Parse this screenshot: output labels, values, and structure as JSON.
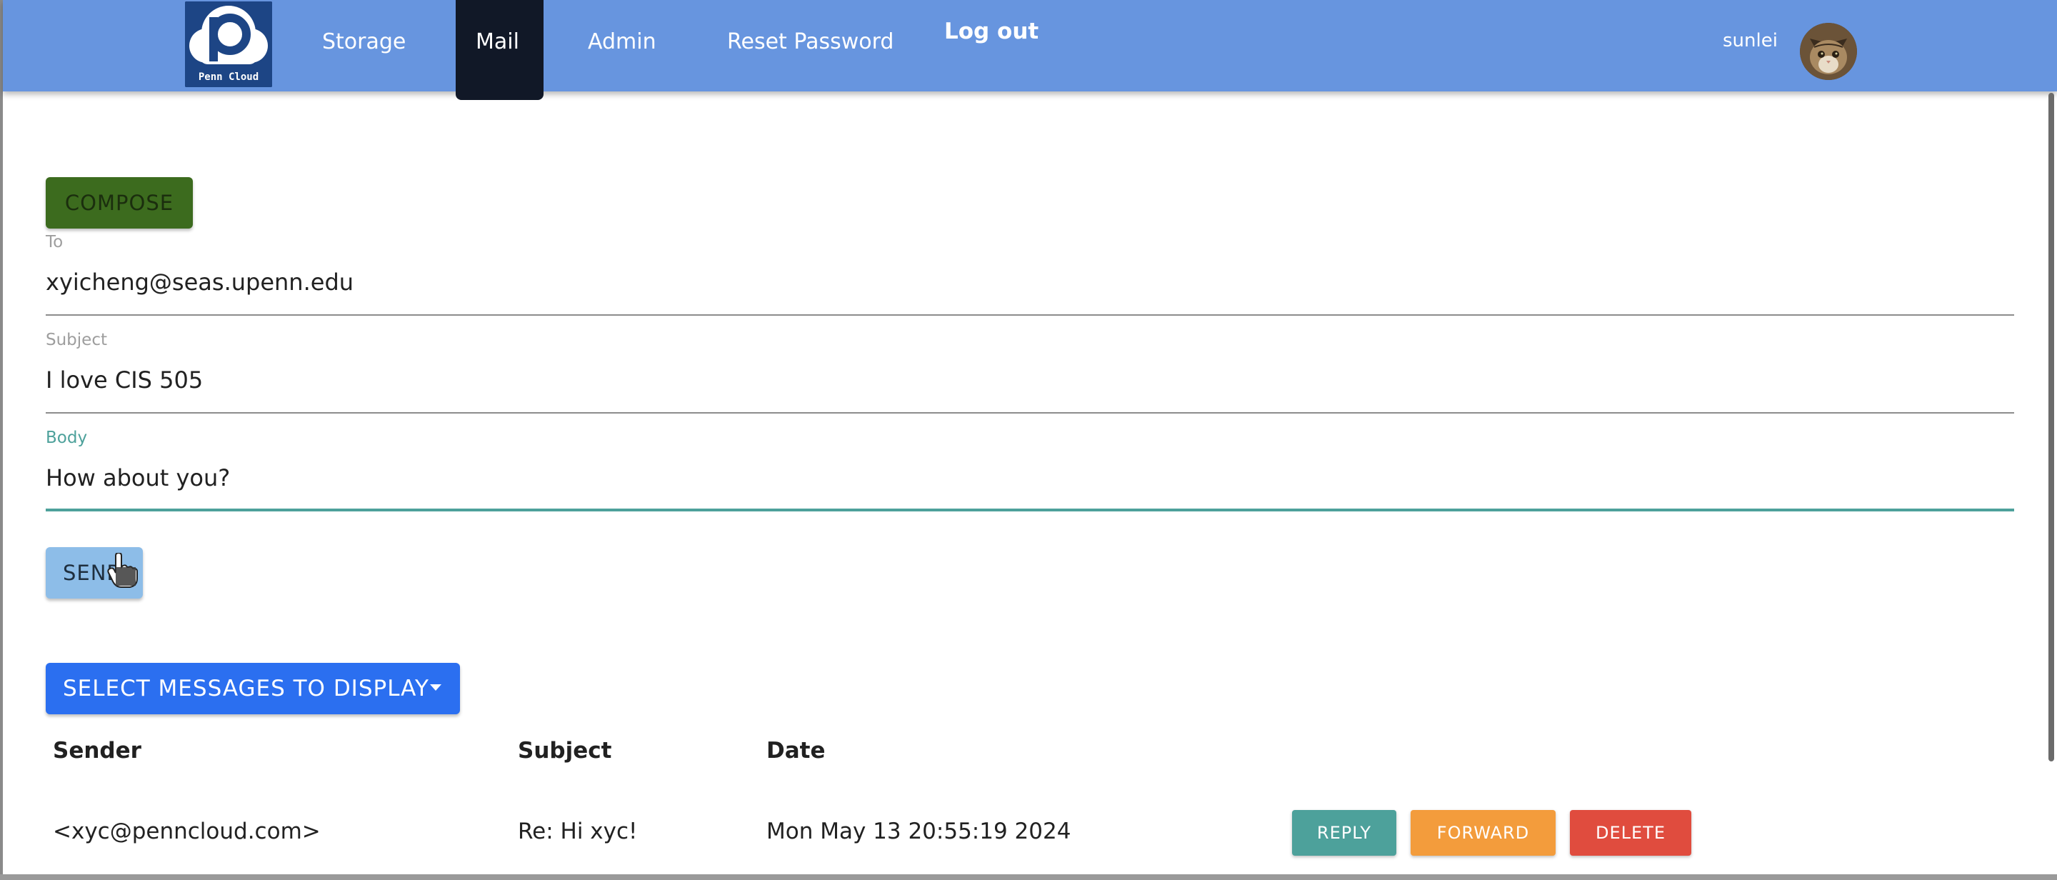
{
  "nav": {
    "logo_text": "Penn Cloud",
    "items": [
      {
        "label": "Storage"
      },
      {
        "label": "Mail"
      },
      {
        "label": "Admin"
      },
      {
        "label": "Reset Password"
      }
    ],
    "logout": "Log out",
    "username": "sunlei"
  },
  "compose": {
    "button": "COMPOSE",
    "to_label": "To",
    "to_value": "xyicheng@seas.upenn.edu",
    "subject_label": "Subject",
    "subject_value": "I love CIS 505",
    "body_label": "Body",
    "body_value": "How about you?",
    "send_button": "SEND"
  },
  "messages": {
    "select_button": "SELECT MESSAGES TO DISPLAY",
    "columns": [
      "Sender",
      "Subject",
      "Date"
    ],
    "rows": [
      {
        "sender": "<xyc@penncloud.com>",
        "subject": "Re: Hi xyc!",
        "date": "Mon May 13 20:55:19 2024",
        "actions": {
          "reply": "REPLY",
          "forward": "FORWARD",
          "delete": "DELETE"
        }
      }
    ]
  },
  "colors": {
    "navbar": "#6795df",
    "nav_active": "#111827",
    "compose": "#3c6b1e",
    "send": "#8dbde8",
    "select": "#2b6ff0",
    "reply": "#4da19b",
    "forward": "#f39c3c",
    "delete": "#e04c3e",
    "focus": "#4da19b"
  }
}
